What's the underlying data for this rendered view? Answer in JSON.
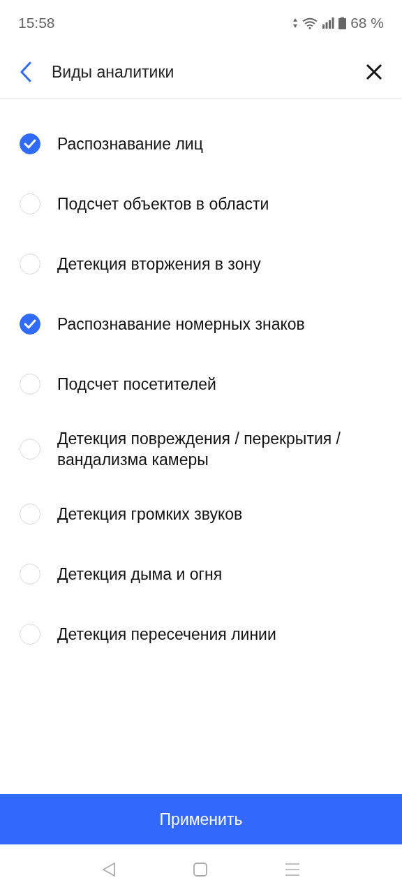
{
  "status_bar": {
    "time": "15:58",
    "battery": "68 %"
  },
  "header": {
    "title": "Виды аналитики"
  },
  "options": [
    {
      "label": "Распознавание лиц",
      "checked": true
    },
    {
      "label": "Подсчет объектов в области",
      "checked": false
    },
    {
      "label": "Детекция вторжения в зону",
      "checked": false
    },
    {
      "label": "Распознавание номерных знаков",
      "checked": true
    },
    {
      "label": "Подсчет посетителей",
      "checked": false
    },
    {
      "label": "Детекция повреждения / перекрытия / вандализма камеры",
      "checked": false
    },
    {
      "label": "Детекция громких звуков",
      "checked": false
    },
    {
      "label": "Детекция дыма и огня",
      "checked": false
    },
    {
      "label": "Детекция пересечения линии",
      "checked": false
    }
  ],
  "apply_button": {
    "label": "Применить"
  }
}
